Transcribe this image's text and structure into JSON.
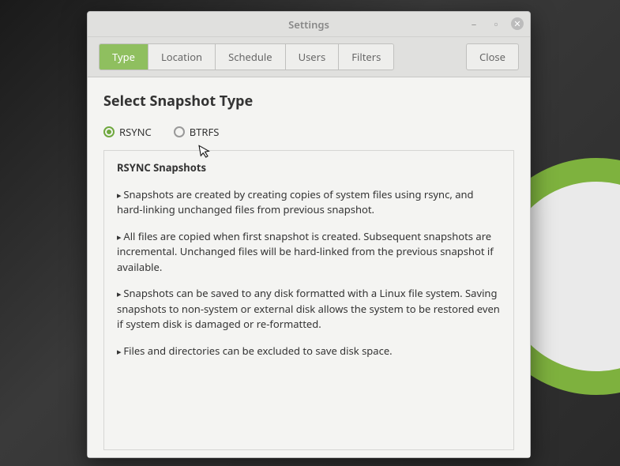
{
  "window": {
    "title": "Settings"
  },
  "toolbar": {
    "tabs": [
      {
        "label": "Type",
        "active": true
      },
      {
        "label": "Location",
        "active": false
      },
      {
        "label": "Schedule",
        "active": false
      },
      {
        "label": "Users",
        "active": false
      },
      {
        "label": "Filters",
        "active": false
      }
    ],
    "close_label": "Close"
  },
  "page": {
    "heading": "Select Snapshot Type",
    "radios": {
      "rsync": "RSYNC",
      "btrfs": "BTRFS",
      "selected": "rsync"
    },
    "info": {
      "title": "RSYNC Snapshots",
      "bullets": [
        "Snapshots are created by creating copies of system files using rsync, and hard-linking unchanged files from previous snapshot.",
        "All files are copied when first snapshot is created. Subsequent snapshots are incremental. Unchanged files will be hard-linked from the previous snapshot if available.",
        "Snapshots can be saved to any disk formatted with a Linux file system. Saving snapshots to non-system or external disk allows the system to be restored even if system disk is damaged or re-formatted.",
        "Files and directories can be excluded to save disk space."
      ]
    }
  }
}
